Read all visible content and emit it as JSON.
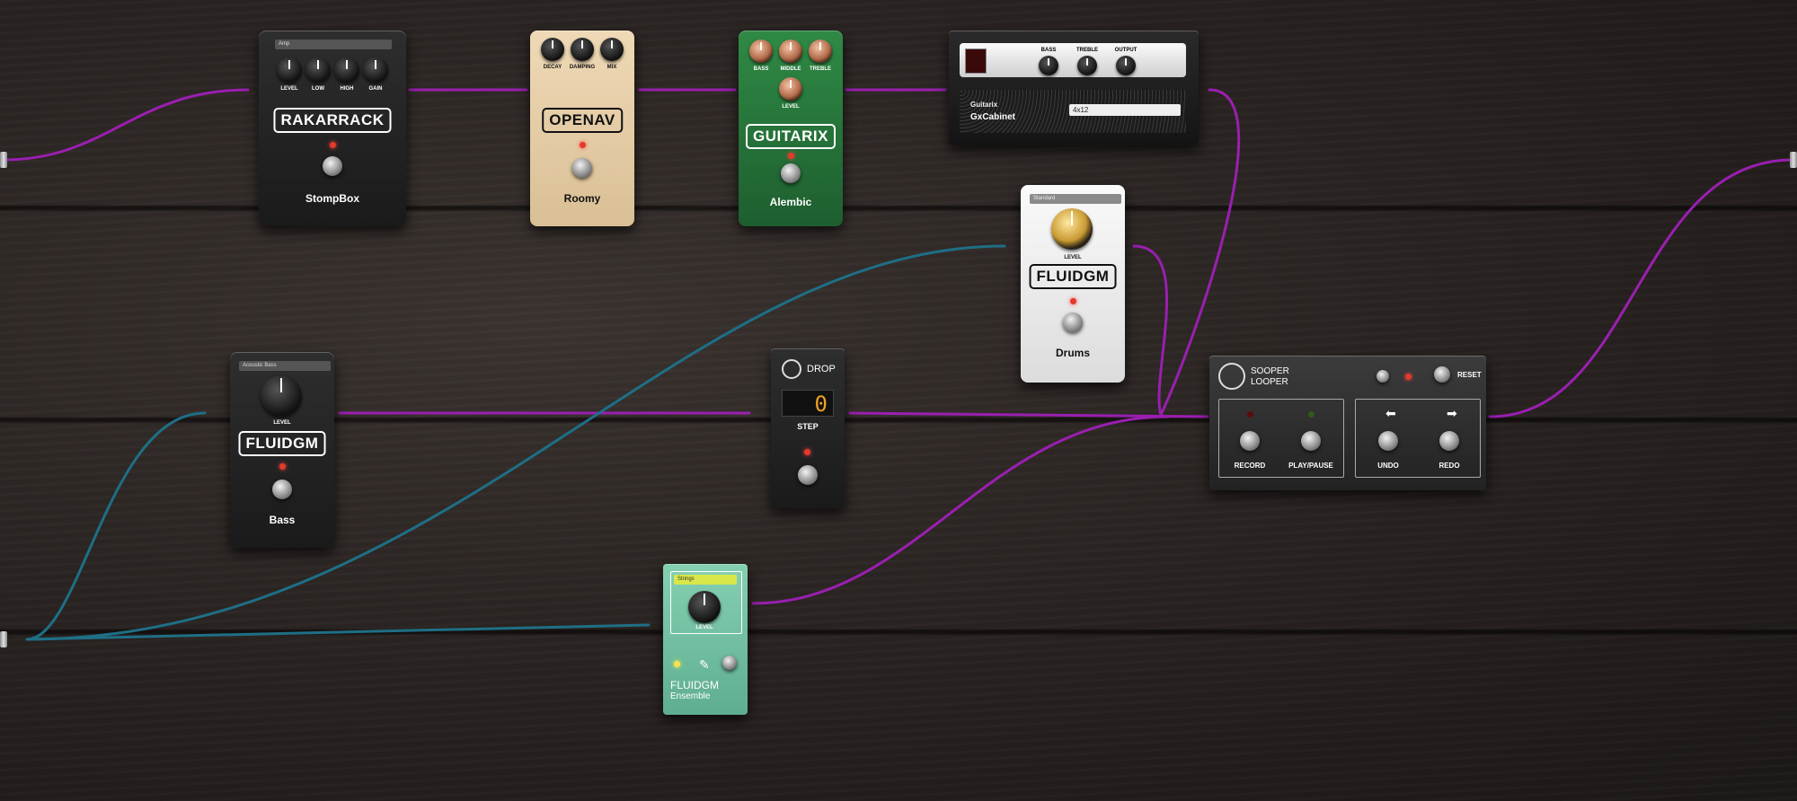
{
  "colors": {
    "cable_audio": "#9a1fb0",
    "cable_midi": "#1e6f86"
  },
  "pedals": {
    "stompbox": {
      "brand": "RAKARRACK",
      "name": "StompBox",
      "preset": "Amp",
      "knobs": [
        "LEVEL",
        "LOW",
        "HIGH",
        "GAIN"
      ]
    },
    "roomy": {
      "brand": "OPENAV",
      "name": "Roomy",
      "knobs": [
        "DECAY",
        "DAMPING",
        "MIX"
      ]
    },
    "alembic": {
      "brand": "GUITARIX",
      "name": "Alembic",
      "knobs": [
        "BASS",
        "MIDDLE",
        "TREBLE",
        "LEVEL"
      ]
    },
    "cabinet": {
      "brand": "Guitarix",
      "name": "GxCabinet",
      "model": "4x12",
      "knobs": [
        "BASS",
        "TREBLE",
        "OUTPUT"
      ]
    },
    "drums": {
      "brand": "FLUIDGM",
      "name": "Drums",
      "preset": "Standard",
      "knob": "LEVEL"
    },
    "bass": {
      "brand": "FLUIDGM",
      "name": "Bass",
      "preset": "Acoustic Bass",
      "knob": "LEVEL"
    },
    "drop": {
      "title": "DROP",
      "display": "0",
      "knob": "STEP"
    },
    "ensemble": {
      "brand": "FLUIDGM",
      "name": "Ensemble",
      "preset": "Strings",
      "knob": "LEVEL"
    },
    "looper": {
      "title_line1": "SOOPER",
      "title_line2": "LOOPER",
      "reset": "RESET",
      "buttons": [
        "RECORD",
        "PLAY/PAUSE",
        "UNDO",
        "REDO"
      ]
    }
  }
}
